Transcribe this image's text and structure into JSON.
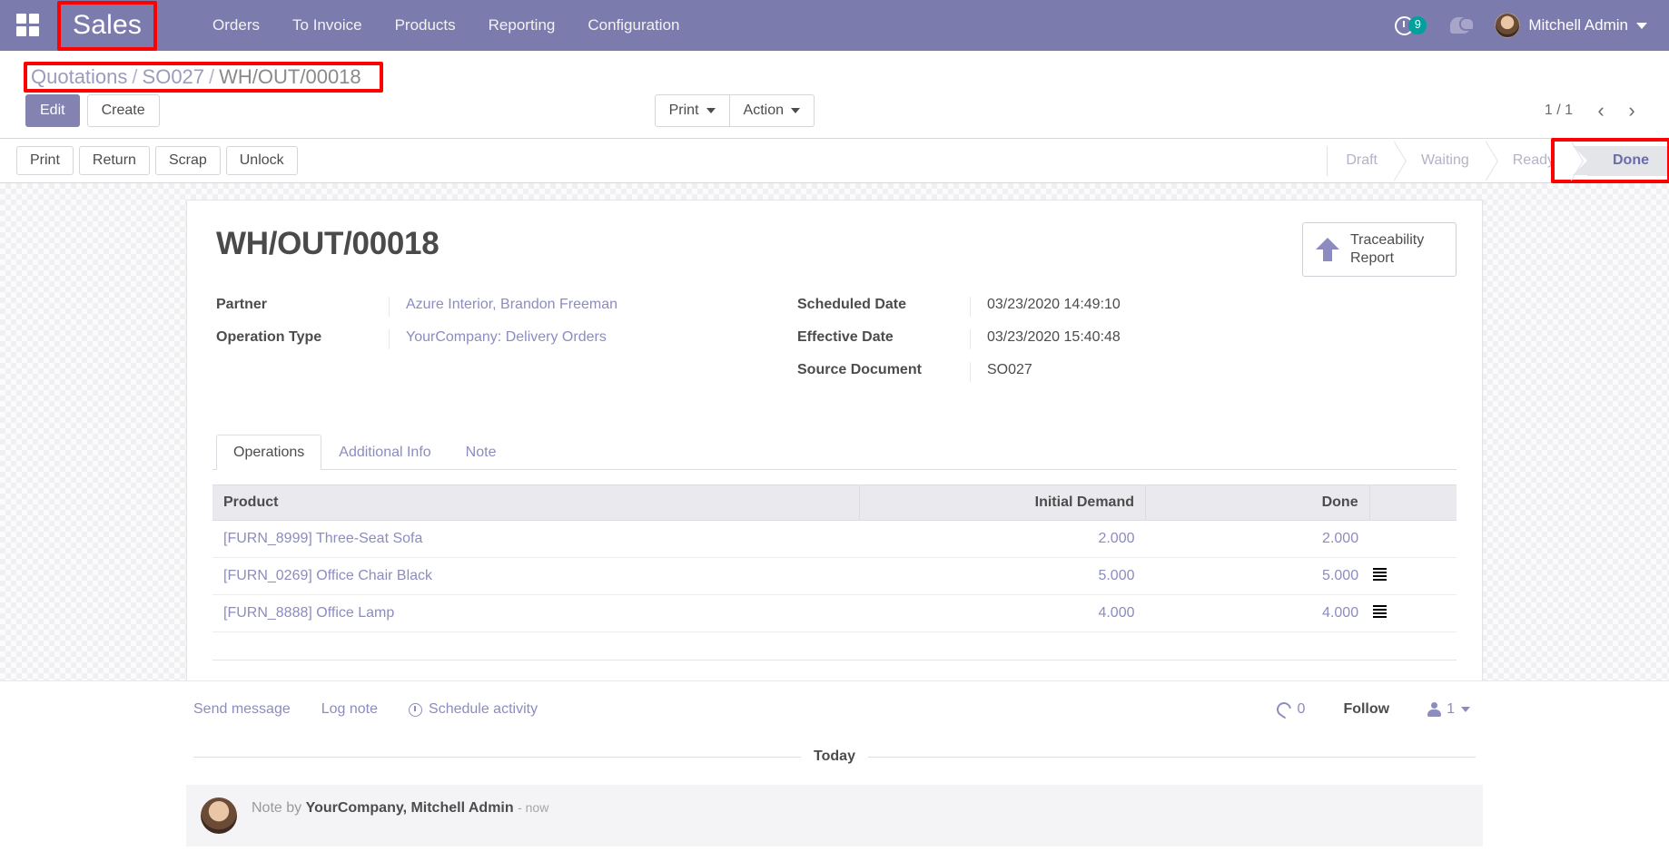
{
  "navbar": {
    "apps_icon": "apps-grid-icon",
    "brand": "Sales",
    "menus": [
      "Orders",
      "To Invoice",
      "Products",
      "Reporting",
      "Configuration"
    ],
    "activity_icon": "clock-icon",
    "activity_count": "9",
    "messages_icon": "chat-bubble-icon",
    "user_name": "Mitchell Admin",
    "accent_color": "#7c7bad",
    "badge_color": "#00a09d"
  },
  "control_panel": {
    "breadcrumb": [
      {
        "label": "Quotations",
        "current": false
      },
      {
        "label": "SO027",
        "current": false
      },
      {
        "label": "WH/OUT/00018",
        "current": true
      }
    ],
    "breadcrumb_separator": "/",
    "edit_label": "Edit",
    "create_label": "Create",
    "print_label": "Print",
    "action_label": "Action",
    "pager": "1 / 1",
    "pager_prev_icon": "chevron-left-icon",
    "pager_next_icon": "chevron-right-icon"
  },
  "statusbar": {
    "buttons": [
      "Print",
      "Return",
      "Scrap",
      "Unlock"
    ],
    "stages": [
      {
        "label": "Draft",
        "active": false
      },
      {
        "label": "Waiting",
        "active": false
      },
      {
        "label": "Ready",
        "active": false
      },
      {
        "label": "Done",
        "active": true
      }
    ],
    "active_stage": "Done",
    "highlight_color": "#ff0000"
  },
  "form": {
    "title": "WH/OUT/00018",
    "stat_button": {
      "icon": "up-arrow-icon",
      "line1": "Traceability",
      "line2": "Report"
    },
    "left_fields": [
      {
        "label": "Partner",
        "value": "Azure Interior, Brandon Freeman",
        "link": true
      },
      {
        "label": "Operation Type",
        "value": "YourCompany: Delivery Orders",
        "link": true
      }
    ],
    "right_fields": [
      {
        "label": "Scheduled Date",
        "value": "03/23/2020 14:49:10",
        "link": false
      },
      {
        "label": "Effective Date",
        "value": "03/23/2020 15:40:48",
        "link": false
      },
      {
        "label": "Source Document",
        "value": "SO027",
        "link": false
      }
    ]
  },
  "notebook": {
    "tabs": [
      {
        "label": "Operations",
        "active": true
      },
      {
        "label": "Additional Info",
        "active": false
      },
      {
        "label": "Note",
        "active": false
      }
    ]
  },
  "operations_table": {
    "columns": [
      "Product",
      "Initial Demand",
      "Done"
    ],
    "rows": [
      {
        "product": "[FURN_8999] Three-Seat Sofa",
        "initial_demand": "2.000",
        "done": "2.000",
        "has_detail_icon": false
      },
      {
        "product": "[FURN_0269] Office Chair Black",
        "initial_demand": "5.000",
        "done": "5.000",
        "has_detail_icon": true
      },
      {
        "product": "[FURN_8888] Office Lamp",
        "initial_demand": "4.000",
        "done": "4.000",
        "has_detail_icon": true
      }
    ],
    "detail_icon": "list-lines-icon"
  },
  "chatter": {
    "send_message": "Send message",
    "log_note": "Log note",
    "schedule_activity": "Schedule activity",
    "schedule_icon": "clock-icon",
    "attachment_icon": "paperclip-icon",
    "attachment_count": "0",
    "follow_label": "Follow",
    "followers_icon": "person-icon",
    "followers_count": "1",
    "day_separator": "Today",
    "message": {
      "prefix": "Note by",
      "author": "YourCompany, Mitchell Admin",
      "time": "- now"
    }
  }
}
